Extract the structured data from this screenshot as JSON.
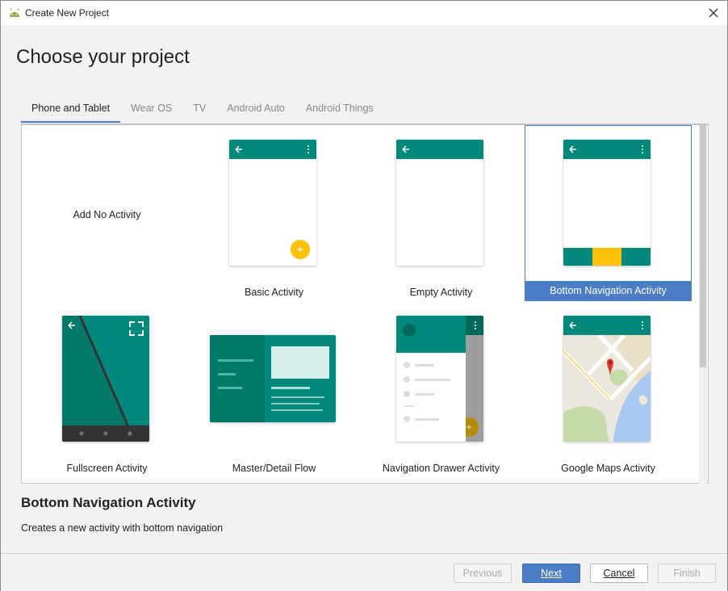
{
  "window": {
    "title": "Create New Project"
  },
  "header": {
    "title": "Choose your project"
  },
  "tabs": [
    {
      "label": "Phone and Tablet",
      "active": true
    },
    {
      "label": "Wear OS",
      "active": false
    },
    {
      "label": "TV",
      "active": false
    },
    {
      "label": "Android Auto",
      "active": false
    },
    {
      "label": "Android Things",
      "active": false
    }
  ],
  "templates": [
    {
      "label": "Add No Activity",
      "selected": false
    },
    {
      "label": "Basic Activity",
      "selected": false
    },
    {
      "label": "Empty Activity",
      "selected": false
    },
    {
      "label": "Bottom Navigation Activity",
      "selected": true
    },
    {
      "label": "Fullscreen Activity",
      "selected": false
    },
    {
      "label": "Master/Detail Flow",
      "selected": false
    },
    {
      "label": "Navigation Drawer Activity",
      "selected": false
    },
    {
      "label": "Google Maps Activity",
      "selected": false
    }
  ],
  "description": {
    "title": "Bottom Navigation Activity",
    "text": "Creates a new activity with bottom navigation"
  },
  "buttons": {
    "previous": "Previous",
    "next": "Next",
    "cancel": "Cancel",
    "finish": "Finish"
  },
  "colors": {
    "teal": "#00897b",
    "accent": "#ffc107",
    "selection": "#4b7cc6"
  }
}
